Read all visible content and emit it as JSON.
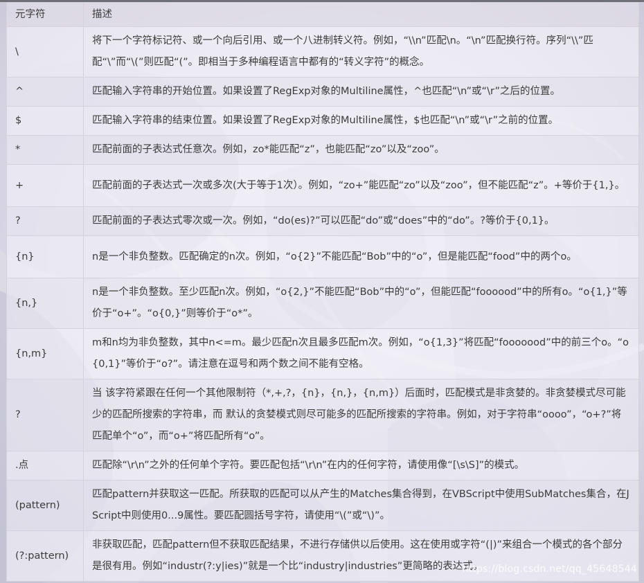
{
  "table": {
    "headers": [
      "元字符",
      "描述"
    ],
    "rows": [
      {
        "sym": "\\",
        "desc": "将下一个字符标记符、或一个向后引用、或一个八进制转义符。例如，“\\\\n”匹配\\n。“\\n”匹配换行符。序列“\\\\”匹配“\\”而“\\(”则匹配“(”。即相当于多种编程语言中都有的“转义字符”的概念。"
      },
      {
        "sym": "^",
        "desc": "匹配输入字符串的开始位置。如果设置了RegExp对象的Multiline属性，^也匹配“\\n”或“\\r”之后的位置。"
      },
      {
        "sym": "$",
        "desc": "匹配输入字符串的结束位置。如果设置了RegExp对象的Multiline属性，$也匹配“\\n”或“\\r”之前的位置。"
      },
      {
        "sym": "*",
        "desc": "匹配前面的子表达式任意次。例如，zo*能匹配“z”，也能匹配“zo”以及“zoo”。"
      },
      {
        "sym": "+",
        "desc": "匹配前面的子表达式一次或多次(大于等于1次）。例如，“zo+”能匹配“zo”以及“zoo”，但不能匹配“z”。+等价于{1,}。"
      },
      {
        "sym": "?",
        "desc": "匹配前面的子表达式零次或一次。例如，“do(es)?”可以匹配“do”或“does”中的“do”。?等价于{0,1}。"
      },
      {
        "sym": "{n}",
        "desc": "n是一个非负整数。匹配确定的n次。例如，“o{2}”不能匹配“Bob”中的“o”，但是能匹配“food”中的两个o。"
      },
      {
        "sym": "{n,}",
        "desc": "n是一个非负整数。至少匹配n次。例如，“o{2,}”不能匹配“Bob”中的“o”，但能匹配“foooood”中的所有o。“o{1,}”等价于“o+”。“o{0,}”则等价于“o*”。"
      },
      {
        "sym": "{n,m}",
        "desc": "m和n均为非负整数，其中n<=m。最少匹配n次且最多匹配m次。例如，“o{1,3}”将匹配“fooooood”中的前三个o。“o{0,1}”等价于“o?”。请注意在逗号和两个数之间不能有空格。"
      },
      {
        "sym": "?",
        "desc": "当 该字符紧跟在任何一个其他限制符（*,+,?，{n}，{n,}，{n,m}）后面时，匹配模式是非贪婪的。非贪婪模式尽可能少的匹配所搜索的字符串，而 默认的贪婪模式则尽可能多的匹配所搜索的字符串。例如，对于字符串“oooo”，“o+?”将匹配单个“o”，而“o+”将匹配所有“o”。"
      },
      {
        "sym": ".点",
        "desc": "匹配除“\\r\\n”之外的任何单个字符。要匹配包括“\\r\\n”在内的任何字符，请使用像“[\\s\\S]”的模式。"
      },
      {
        "sym": "(pattern)",
        "desc": "匹配pattern并获取这一匹配。所获取的匹配可以从产生的Matches集合得到，在VBScript中使用SubMatches集合，在JScript中则使用0...9属性。要匹配圆括号字符，请使用“\\(”或“\\)”。"
      },
      {
        "sym": "(?:pattern)",
        "desc": "非获取匹配，匹配pattern但不获取匹配结果，不进行存储供以后使用。这在使用或字符“(|)”来组合一个模式的各个部分是很有用。例如“industr(?:y|ies)”就是一个比“industry|industries”更简略的表达式。"
      }
    ]
  },
  "watermark": "https://blog.csdn.net/qq_45648544"
}
